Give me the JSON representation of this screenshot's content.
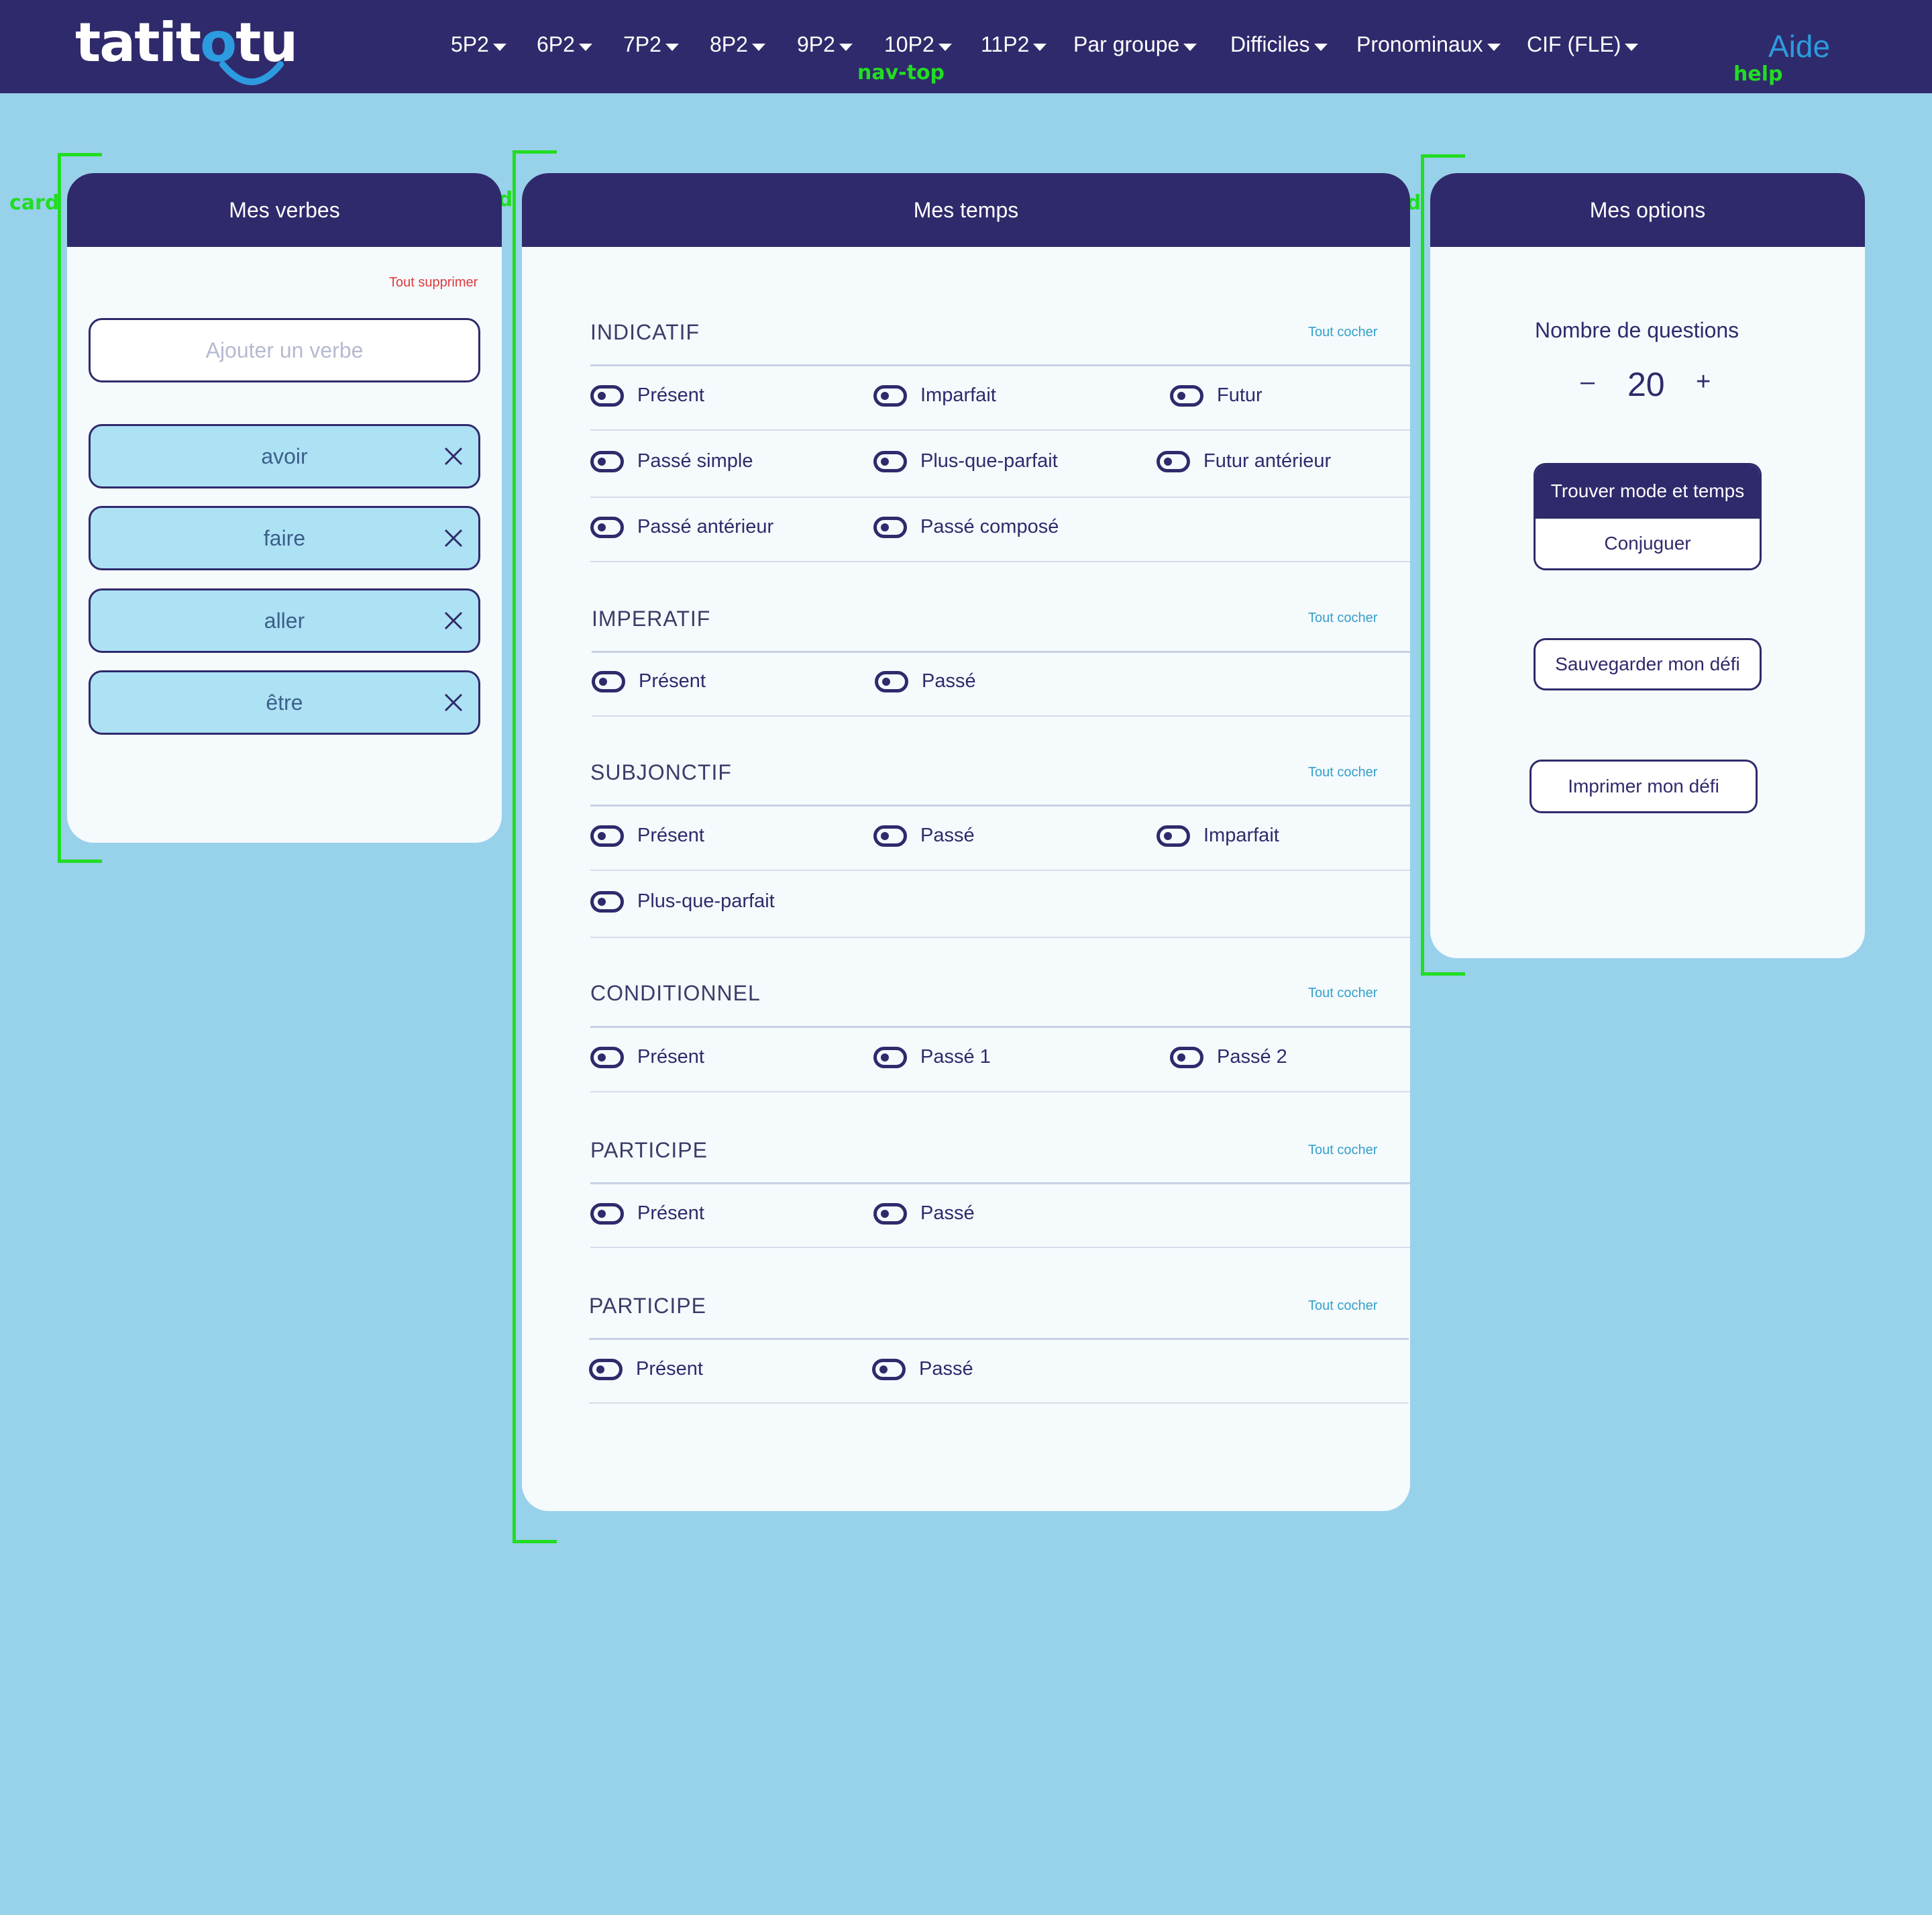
{
  "brand": {
    "logo_prefix": "tatit",
    "logo_o": "o",
    "logo_suffix": "tu"
  },
  "nav": {
    "items": [
      "5P2",
      "6P2",
      "7P2",
      "8P2",
      "9P2",
      "10P2",
      "11P2",
      "Par groupe",
      "Difficiles",
      "Pronominaux",
      "CIF (FLE)"
    ],
    "help": "Aide"
  },
  "annotations": {
    "nav_top": "nav-top",
    "help": "help",
    "card": "card",
    "search": "search",
    "all_sel": "all-sel",
    "verb_sel": "verb-sel",
    "section_mode": "section-mode",
    "check_tense": "check-tense",
    "number_field": "number-field",
    "radio_button": "radio-button",
    "button": "button"
  },
  "verbs_card": {
    "title": "Mes verbes",
    "clear_all": "Tout supprimer",
    "search_placeholder": "Ajouter un verbe",
    "verbs": [
      "avoir",
      "faire",
      "aller",
      "être"
    ]
  },
  "tenses_card": {
    "title": "Mes temps",
    "check_all": "Tout cocher",
    "sections": [
      {
        "title": "INDICATIF",
        "tenses": [
          "Présent",
          "Imparfait",
          "Futur",
          "Passé simple",
          "Plus-que-parfait",
          "Futur antérieur",
          "Passé antérieur",
          "Passé composé"
        ]
      },
      {
        "title": "IMPERATIF",
        "tenses": [
          "Présent",
          "Passé"
        ]
      },
      {
        "title": "SUBJONCTIF",
        "tenses": [
          "Présent",
          "Passé",
          "Imparfait",
          "Plus-que-parfait"
        ]
      },
      {
        "title": "CONDITIONNEL",
        "tenses": [
          "Présent",
          "Passé 1",
          "Passé 2"
        ]
      },
      {
        "title": "PARTICIPE",
        "tenses": [
          "Présent",
          "Passé"
        ]
      },
      {
        "title": "PARTICIPE",
        "tenses": [
          "Présent",
          "Passé"
        ]
      }
    ]
  },
  "options_card": {
    "title": "Mes options",
    "questions_label": "Nombre de questions",
    "questions_value": "20",
    "minus": "–",
    "plus": "+",
    "mode_options": [
      "Trouver mode et temps",
      "Conjuguer"
    ],
    "save": "Sauvegarder mon défi",
    "print": "Imprimer mon défi"
  },
  "colors": {
    "navy": "#2f2a6b",
    "page_bg": "#98d1ea",
    "chip_bg": "#ade2f5",
    "accent_blue": "#2d9be0",
    "clear_red": "#e03a3a",
    "annotation_green": "#22dd22"
  }
}
